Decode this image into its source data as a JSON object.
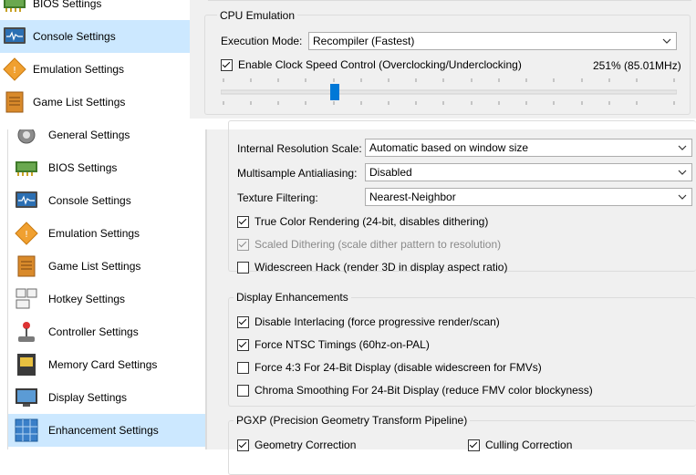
{
  "top_sidebar": {
    "items": [
      {
        "label": "BIOS Settings",
        "icon": "bios-chip-icon"
      },
      {
        "label": "Console Settings",
        "icon": "console-monitor-icon",
        "selected": true
      },
      {
        "label": "Emulation Settings",
        "icon": "emulation-diamond-icon"
      },
      {
        "label": "Game List Settings",
        "icon": "game-list-icon"
      }
    ]
  },
  "cpu_emulation": {
    "title": "CPU Emulation",
    "execution_mode_label": "Execution Mode:",
    "execution_mode_value": "Recompiler (Fastest)",
    "clock_control_label": "Enable Clock Speed Control (Overclocking/Underclocking)",
    "clock_control_checked": true,
    "clock_value": "251% (85.01MHz)"
  },
  "bottom_sidebar": {
    "items": [
      {
        "label": "General Settings",
        "icon": "gear-icon"
      },
      {
        "label": "BIOS Settings",
        "icon": "bios-chip-icon"
      },
      {
        "label": "Console Settings",
        "icon": "console-monitor-icon"
      },
      {
        "label": "Emulation Settings",
        "icon": "emulation-diamond-icon"
      },
      {
        "label": "Game List Settings",
        "icon": "game-list-icon"
      },
      {
        "label": "Hotkey Settings",
        "icon": "hotkey-keyboard-icon"
      },
      {
        "label": "Controller Settings",
        "icon": "joystick-icon"
      },
      {
        "label": "Memory Card Settings",
        "icon": "memory-card-icon"
      },
      {
        "label": "Display Settings",
        "icon": "display-monitor-icon"
      },
      {
        "label": "Enhancement Settings",
        "icon": "enhancement-grid-icon",
        "selected": true
      }
    ]
  },
  "enhancement": {
    "resolution_label": "Internal Resolution Scale:",
    "resolution_value": "Automatic based on window size",
    "msaa_label": "Multisample Antialiasing:",
    "msaa_value": "Disabled",
    "texture_label": "Texture Filtering:",
    "texture_value": "Nearest-Neighbor",
    "true_color_label": "True Color Rendering (24-bit, disables dithering)",
    "scaled_dither_label": "Scaled Dithering (scale dither pattern to resolution)",
    "widescreen_label": "Widescreen Hack (render 3D in display aspect ratio)",
    "display_enh_title": "Display Enhancements",
    "disable_interlacing_label": "Disable Interlacing (force progressive render/scan)",
    "force_ntsc_label": "Force NTSC Timings (60hz-on-PAL)",
    "force_43_label": "Force 4:3 For 24-Bit Display (disable widescreen for FMVs)",
    "chroma_label": "Chroma Smoothing For 24-Bit Display (reduce FMV color blockyness)",
    "pgxp_title": "PGXP (Precision Geometry Transform Pipeline)",
    "geometry_label": "Geometry Correction",
    "culling_label": "Culling Correction"
  }
}
